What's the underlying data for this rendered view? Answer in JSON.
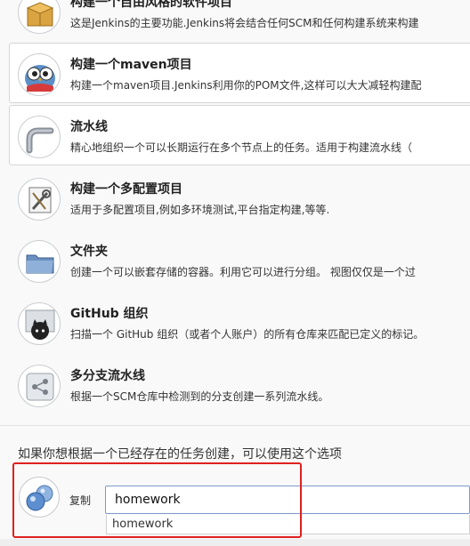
{
  "items": [
    {
      "title": "构建一个自由风格的软件项目",
      "desc": "这是Jenkins的主要功能.Jenkins将会结合任何SCM和任何构建系统来构建",
      "icon": "freestyle-box-icon"
    },
    {
      "title": "构建一个maven项目",
      "desc": "构建一个maven项目.Jenkins利用你的POM文件,这样可以大大减轻构建配",
      "icon": "maven-owl-icon"
    },
    {
      "title": "流水线",
      "desc": "精心地组织一个可以长期运行在多个节点上的任务。适用于构建流水线（",
      "icon": "pipeline-pipe-icon"
    },
    {
      "title": "构建一个多配置项目",
      "desc": "适用于多配置项目,例如多环境测试,平台指定构建,等等.",
      "icon": "multi-config-tools-icon"
    },
    {
      "title": "文件夹",
      "desc": "创建一个可以嵌套存储的容器。利用它可以进行分组。 视图仅仅是一个过",
      "icon": "folder-icon"
    },
    {
      "title": "GitHub 组织",
      "desc": "扫描一个 GitHub 组织（或者个人账户）的所有仓库来匹配已定义的标记。",
      "icon": "github-octocat-icon"
    },
    {
      "title": "多分支流水线",
      "desc": "根据一个SCM仓库中检测到的分支创建一系列流水线。",
      "icon": "multibranch-pipeline-icon"
    }
  ],
  "copy": {
    "hint": "如果你想根据一个已经存在的任务创建，可以使用这个选项",
    "label": "复制",
    "input_value": "homework",
    "suggestions": [
      "homework"
    ],
    "icon": "copy-spheres-icon"
  },
  "colors": {
    "highlight": "#e02020",
    "input_border": "#7d9cc9",
    "selected_bg": "#ffffff"
  }
}
